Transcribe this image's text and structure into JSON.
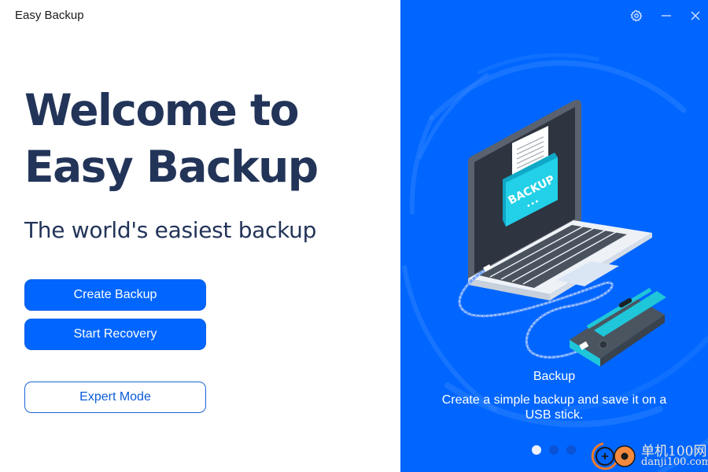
{
  "app": {
    "title": "Easy Backup"
  },
  "hero": {
    "welcome_line1": "Welcome to",
    "welcome_line2": "Easy Backup",
    "tagline": "The world's easiest backup"
  },
  "actions": {
    "create_backup": "Create Backup",
    "start_recovery": "Start Recovery",
    "expert_mode": "Expert Mode"
  },
  "window_controls": {
    "settings": "settings-gear-icon",
    "minimize": "minimize-icon",
    "close": "close-icon"
  },
  "carousel": {
    "illustration": {
      "folder_label": "BACKUP",
      "folder_dots": "•••"
    },
    "slide_title": "Backup",
    "slide_description": "Create a simple backup and save it on a USB stick.",
    "slide_count": 3,
    "active_slide": 1
  },
  "watermark": {
    "line1": "单机100网",
    "line2": "danji100.com"
  },
  "colors": {
    "accent": "#0066ff",
    "heading": "#233459",
    "dot_inactive": "#0a52d6",
    "dot_active": "#eef2ff"
  }
}
